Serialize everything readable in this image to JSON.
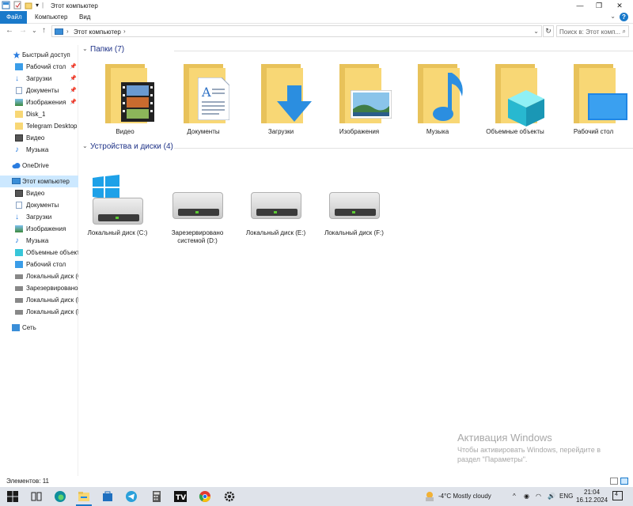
{
  "window": {
    "title": "Этот компьютер",
    "minimize": "—",
    "maximize": "❐",
    "close": "✕"
  },
  "ribbon": {
    "tabs": [
      "Файл",
      "Компьютер",
      "Вид"
    ],
    "help": "?"
  },
  "address": {
    "back": "←",
    "forward": "→",
    "recent": "⌄",
    "up": "↑",
    "path": "Этот компьютер",
    "refresh": "↻",
    "search_placeholder": "Поиск в: Этот комп..."
  },
  "sidebar": {
    "quick_access": "Быстрый доступ",
    "quick_items": [
      "Рабочий стол",
      "Загрузки",
      "Документы",
      "Изображения",
      "Disk_1",
      "Telegram Desktop",
      "Видео",
      "Музыка"
    ],
    "pinned_count": 4,
    "onedrive": "OneDrive",
    "this_pc": "Этот компьютер",
    "pc_items": [
      "Видео",
      "Документы",
      "Загрузки",
      "Изображения",
      "Музыка",
      "Объемные объекты",
      "Рабочий стол",
      "Локальный диск (C:)",
      "Зарезервировано системой (D:)",
      "Локальный диск (E:)",
      "Локальный диск (F:)"
    ],
    "network": "Сеть"
  },
  "content": {
    "folders_header": "Папки (7)",
    "folders": [
      "Видео",
      "Документы",
      "Загрузки",
      "Изображения",
      "Музыка",
      "Объемные объекты",
      "Рабочий стол"
    ],
    "drives_header": "Устройства и диски (4)",
    "drives": [
      "Локальный диск (C:)",
      "Зарезервировано системой (D:)",
      "Локальный диск (E:)",
      "Локальный диск (F:)"
    ]
  },
  "status": {
    "items": "Элементов: 11"
  },
  "watermark": {
    "line1": "Активация Windows",
    "line2": "Чтобы активировать Windows, перейдите в",
    "line3": "раздел \"Параметры\"."
  },
  "taskbar": {
    "weather": "-4°C  Mostly cloudy",
    "lang": "ENG",
    "time": "21:04",
    "date": "16.12.2024",
    "notifications": "4"
  },
  "colors": {
    "accent": "#1979ca",
    "selection": "#cce8ff",
    "folder": "#f8d775",
    "group_header": "#1e3287"
  }
}
